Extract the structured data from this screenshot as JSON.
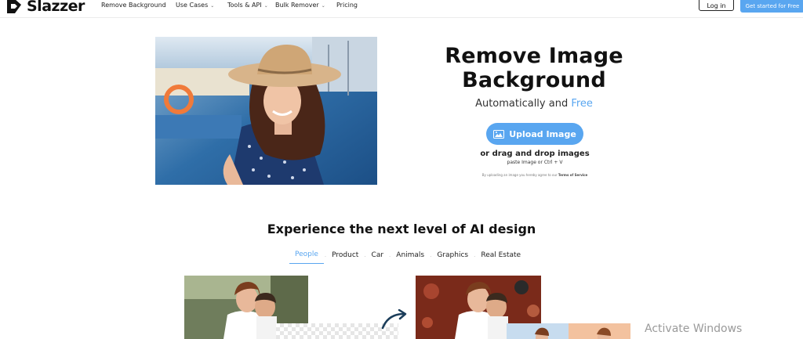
{
  "brand": {
    "name": "Slazzer"
  },
  "nav": {
    "items": [
      {
        "label": "Remove Background",
        "dropdown": false
      },
      {
        "label": "Use Cases",
        "dropdown": true
      },
      {
        "label": "Tools & API",
        "dropdown": true
      },
      {
        "label": "Bulk Remover",
        "dropdown": true
      },
      {
        "label": "Pricing",
        "dropdown": false
      }
    ],
    "login_label": "Log in",
    "cta_label": "Get started for Free"
  },
  "hero": {
    "title": "Remove Image Background",
    "subtitle_prefix": "Automatically and ",
    "subtitle_highlight": "Free",
    "upload_label": "Upload Image",
    "drag_text": "or drag and drop images",
    "paste_text": "paste Image or Ctrl + V",
    "terms_prefix": "By uploading an image you hereby agree to our ",
    "terms_link": "Terms of Service"
  },
  "section": {
    "title": "Experience the next level of AI design",
    "tabs": [
      "People",
      "Product",
      "Car",
      "Animals",
      "Graphics",
      "Real Estate"
    ],
    "active_tab": "People"
  },
  "watermark": {
    "text": "Activate Windows"
  },
  "colors": {
    "accent": "#59a6f0",
    "text": "#111111"
  }
}
